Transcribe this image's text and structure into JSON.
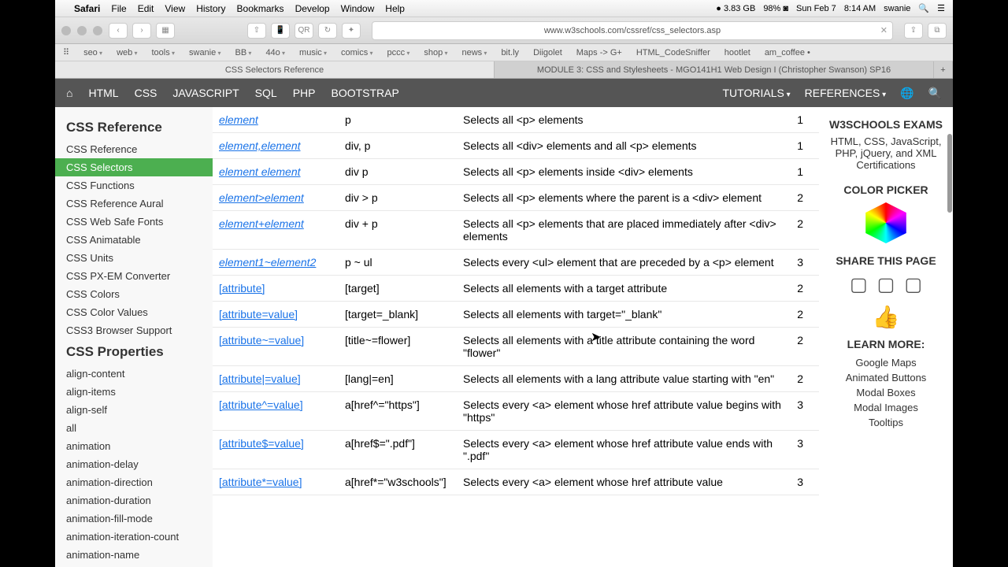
{
  "menubar": {
    "app": "Safari",
    "items": [
      "File",
      "Edit",
      "View",
      "History",
      "Bookmarks",
      "Develop",
      "Window",
      "Help"
    ],
    "ram": "3.83 GB",
    "battery": "98%",
    "date": "Sun Feb 7",
    "time": "8:14 AM",
    "user": "swanie"
  },
  "url": "www.w3schools.com/cssref/css_selectors.asp",
  "favs": [
    "seo",
    "web",
    "tools",
    "swanie",
    "BB",
    "44o",
    "music",
    "comics",
    "pccc",
    "shop",
    "news"
  ],
  "favs2": [
    "bit.ly",
    "Diigolet",
    "Maps -> G+",
    "HTML_CodeSniffer",
    "hootlet",
    "am_coffee •"
  ],
  "tabs": [
    "CSS Selectors Reference",
    "MODULE 3: CSS and Stylesheets - MGO141H1 Web Design I (Christopher Swanson) SP16"
  ],
  "nav": [
    "HTML",
    "CSS",
    "JAVASCRIPT",
    "SQL",
    "PHP",
    "BOOTSTRAP"
  ],
  "navr": [
    "TUTORIALS",
    "REFERENCES"
  ],
  "side1": {
    "title": "CSS Reference",
    "items": [
      "CSS Reference",
      "CSS Selectors",
      "CSS Functions",
      "CSS Reference Aural",
      "CSS Web Safe Fonts",
      "CSS Animatable",
      "CSS Units",
      "CSS PX-EM Converter",
      "CSS Colors",
      "CSS Color Values",
      "CSS3 Browser Support"
    ]
  },
  "side2": {
    "title": "CSS Properties",
    "items": [
      "align-content",
      "align-items",
      "align-self",
      "all",
      "animation",
      "animation-delay",
      "animation-direction",
      "animation-duration",
      "animation-fill-mode",
      "animation-iteration-count",
      "animation-name"
    ]
  },
  "rows": [
    {
      "s": "element",
      "e": "p",
      "d": "Selects all <p> elements",
      "c": "1"
    },
    {
      "s": "element,element",
      "e": "div, p",
      "d": "Selects all <div> elements and all <p> elements",
      "c": "1"
    },
    {
      "s": "element element",
      "e": "div p",
      "d": "Selects all <p> elements inside <div> elements",
      "c": "1"
    },
    {
      "s": "element>element",
      "e": "div > p",
      "d": "Selects all <p> elements where the parent is a <div> element",
      "c": "2"
    },
    {
      "s": "element+element",
      "e": "div + p",
      "d": "Selects all <p> elements that are placed immediately after <div> elements",
      "c": "2"
    },
    {
      "s": "element1~element2",
      "e": "p ~ ul",
      "d": "Selects every <ul> element that are preceded by a <p> element",
      "c": "3"
    },
    {
      "s": "[attribute]",
      "e": "[target]",
      "d": "Selects all elements with a target attribute",
      "c": "2",
      "nb": 1
    },
    {
      "s": "[attribute=value]",
      "e": "[target=_blank]",
      "d": "Selects all elements with target=\"_blank\"",
      "c": "2",
      "nb": 1
    },
    {
      "s": "[attribute~=value]",
      "e": "[title~=flower]",
      "d": "Selects all elements with a title attribute containing the word \"flower\"",
      "c": "2",
      "nb": 1
    },
    {
      "s": "[attribute|=value]",
      "e": "[lang|=en]",
      "d": "Selects all elements with a lang attribute value starting with \"en\"",
      "c": "2",
      "nb": 1
    },
    {
      "s": "[attribute^=value]",
      "e": "a[href^=\"https\"]",
      "d": "Selects every <a> element whose href attribute value begins with \"https\"",
      "c": "3",
      "nb": 1
    },
    {
      "s": "[attribute$=value]",
      "e": "a[href$=\".pdf\"]",
      "d": "Selects every <a> element whose href attribute value ends with \".pdf\"",
      "c": "3",
      "nb": 1
    },
    {
      "s": "[attribute*=value]",
      "e": "a[href*=\"w3schools\"]",
      "d": "Selects every <a> element whose href attribute value",
      "c": "3",
      "nb": 1
    }
  ],
  "rsb": {
    "exams": "W3SCHOOLS EXAMS",
    "examtxt": "HTML, CSS, JavaScript, PHP, jQuery, and XML Certifications",
    "cp": "COLOR PICKER",
    "share": "SHARE THIS PAGE",
    "learn": "LEARN MORE:",
    "links": [
      "Google Maps",
      "Animated Buttons",
      "Modal Boxes",
      "Modal Images",
      "Tooltips"
    ]
  }
}
